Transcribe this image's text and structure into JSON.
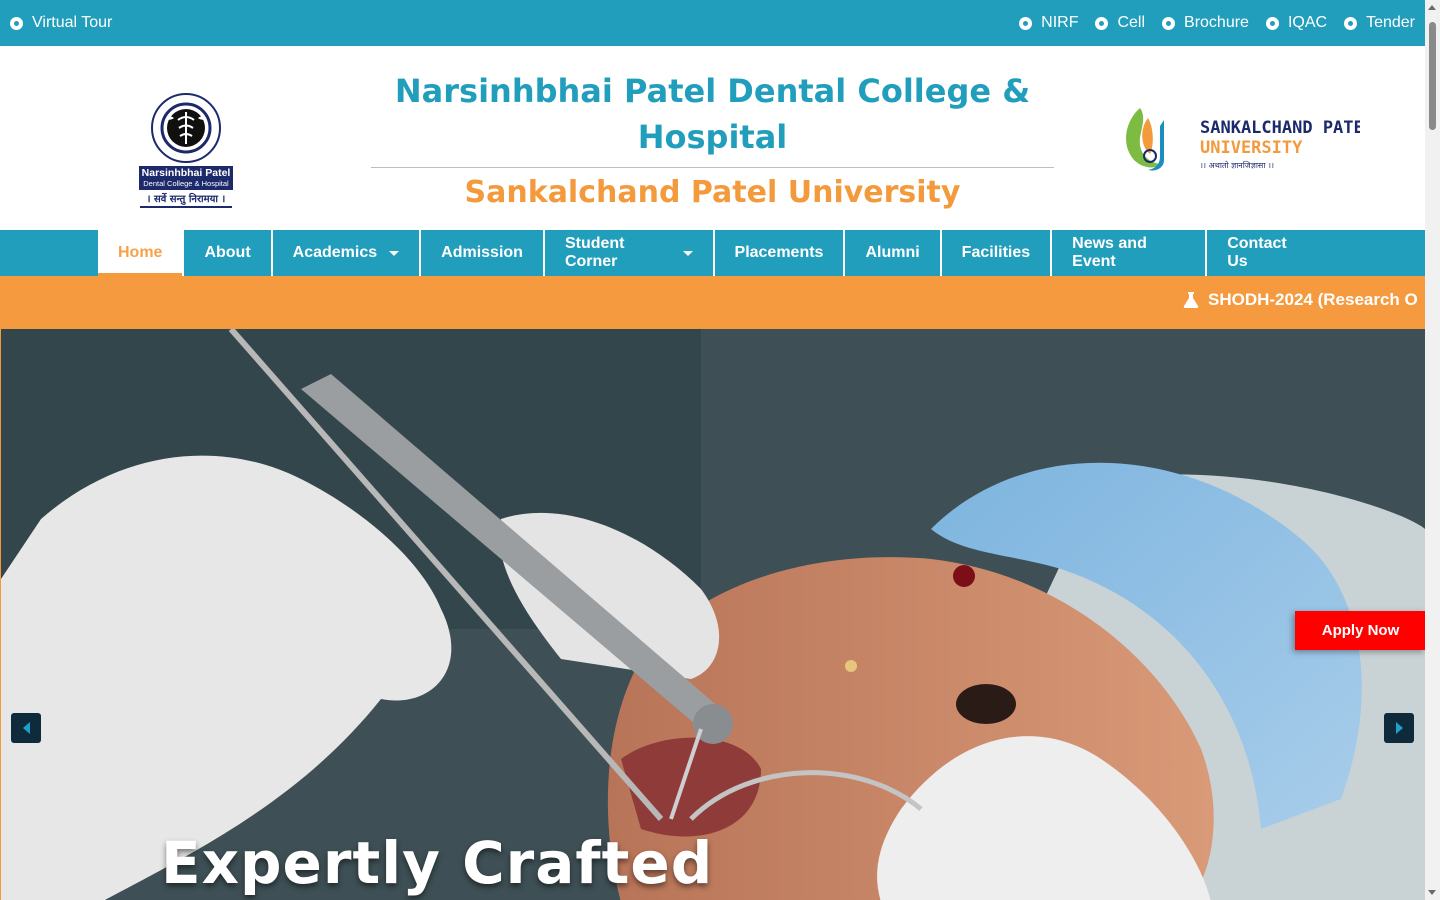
{
  "topbar": {
    "left": {
      "label": "Virtual Tour"
    },
    "right": [
      {
        "label": "NIRF"
      },
      {
        "label": "Cell"
      },
      {
        "label": "Brochure"
      },
      {
        "label": "IQAC"
      },
      {
        "label": "Tender"
      }
    ]
  },
  "header": {
    "title_line1": "Narsinhbhai Patel Dental College &",
    "title_line2": "Hospital",
    "subtitle": "Sankalchand Patel University",
    "logo_left": {
      "text1": "Narsinhbhai Patel",
      "text2": "Dental College & Hospital",
      "motto": "। सर्वे सन्तु निरामया ।",
      "ring_text": "Unit of Nootan Sarva Vidyalaya Kelavani Mandal"
    },
    "logo_right": {
      "line1": "SANKALCHAND PATEL",
      "line2": "UNIVERSITY",
      "tagline": "।। अथातो ज्ञानजिज्ञासा ।।"
    }
  },
  "nav": {
    "tabs": [
      {
        "label": "Home",
        "active": true
      },
      {
        "label": "About"
      },
      {
        "label": "Academics",
        "dropdown": true
      },
      {
        "label": "Admission"
      },
      {
        "label": "Student Corner",
        "dropdown": true
      },
      {
        "label": "Placements"
      },
      {
        "label": "Alumni"
      },
      {
        "label": "Facilities"
      },
      {
        "label": "News and Event"
      },
      {
        "label": "Contact Us"
      }
    ]
  },
  "ticker": {
    "icon": "flask-icon",
    "text": "SHODH-2024 (Research O"
  },
  "hero": {
    "caption": "Expertly Crafted",
    "apply_label": "Apply Now"
  },
  "colors": {
    "primary": "#229ebd",
    "accent": "#f39a3d",
    "apply": "#ff0000"
  }
}
